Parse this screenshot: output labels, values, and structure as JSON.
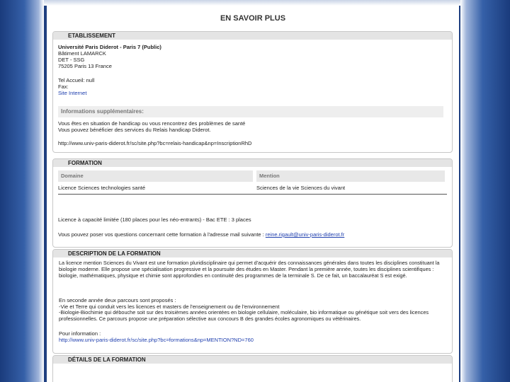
{
  "page": {
    "title": "EN SAVOIR PLUS"
  },
  "etablissement": {
    "heading": "ETABLISSEMENT",
    "lines": [
      "Université Paris Diderot - Paris 7 (Public)",
      "Bâtiment LAMARCK",
      "DET - SSG",
      "75205 Paris 13 France"
    ],
    "tel": "Tel Accueil: null",
    "fax": "Fax:",
    "website": "Site Internet",
    "info_heading": "Informations supplémentaires:",
    "info_lines": [
      "Vous êtes en situation de handicap ou vous rencontrez des problèmes de santé",
      "Vous pouvez bénéficier des services du Relais handicap Diderot."
    ],
    "info_url": "http://www.univ-paris-diderot.fr/sc/site.php?bc=relais-handicap&np=InscriptionRhD"
  },
  "formation": {
    "heading": "FORMATION",
    "columns": [
      "Domaine",
      "Mention"
    ],
    "row": {
      "domaine": "Licence   Sciences   technologies   santé",
      "mention": "Sciences de la vie   Sciences du vivant"
    },
    "capacity": "Licence à capacité limitée (180 places pour les néo-entrants) - Bac ETE : 3 places",
    "contact_text": "Vous pouvez poser vos questions concernant cette formation à l'adresse mail suivante :",
    "contact_email": "reine.rigault@univ-paris-diderot.fr"
  },
  "description": {
    "heading": "DESCRIPTION DE LA FORMATION",
    "para1": "La licence mention Sciences du Vivant est une formation pluridisciplinaire qui permet d'acquérir des connaissances générales dans toutes les disciplines constituant la biologie moderne. Elle propose une spécialisation progressive et la poursuite des études en Master. Pendant la première année, toutes les disciplines scientifiques : biologie, mathématiques, physique et chimie sont approfondies en continuité des programmes de la terminale S. De ce fait, un baccalauréat S est exigé.",
    "para2_intro": "En seconde année deux parcours sont proposés :",
    "para2_vie": "-Vie et Terre qui conduit vers les licences et masters de l'enseignement ou de l'environnement",
    "para2_bio": "-Biologie-Biochimie qui débouche soit sur des troisièmes années orientées en biologie cellulaire, moléculaire, bio informatique ou génétique soit vers des licences professionnelles. Ce parcours propose une préparation sélective aux concours B des grandes écoles agronomiques ou vétérinaires.",
    "info_label": "Pour information :",
    "info_url": "http://www.univ-paris-diderot.fr/sc/site.php?bc=formations&np=MENTION?ND=760"
  },
  "details": {
    "heading": "DÉTAILS DE LA FORMATION"
  }
}
